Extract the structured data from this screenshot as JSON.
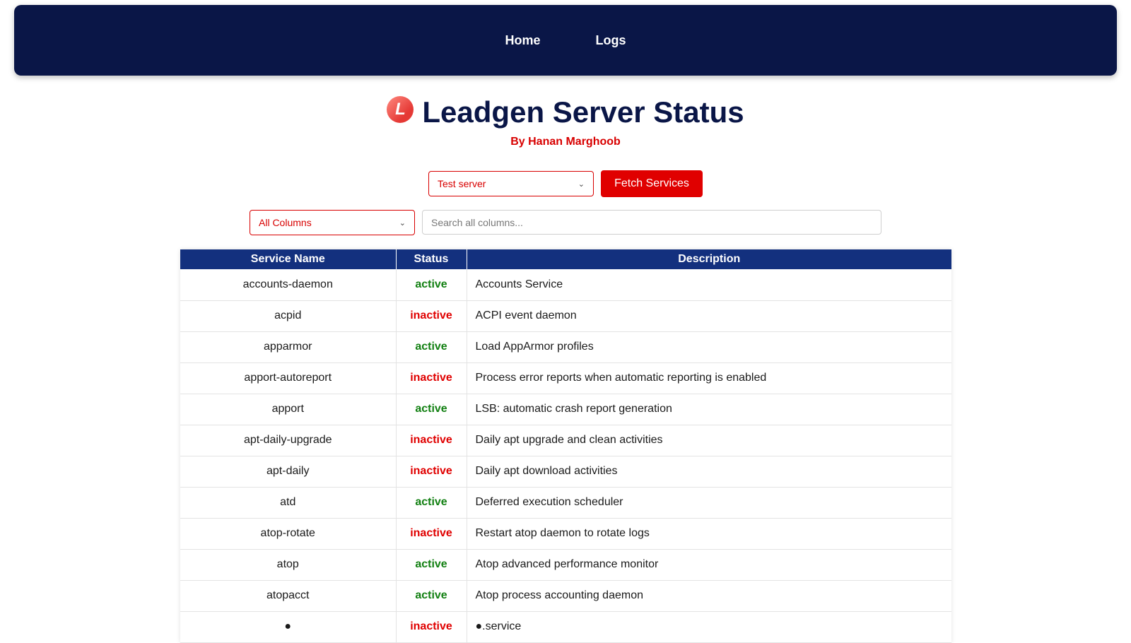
{
  "nav": {
    "home": "Home",
    "logs": "Logs"
  },
  "header": {
    "logo_letter": "L",
    "title": "Leadgen Server Status",
    "byline": "By Hanan Marghoob"
  },
  "controls": {
    "server_select_value": "Test server",
    "fetch_button": "Fetch Services",
    "column_select_value": "All Columns",
    "search_placeholder": "Search all columns..."
  },
  "colors": {
    "navbar": "#0a1647",
    "table_header": "#13307e",
    "accent_red": "#e00000",
    "active_green": "#128012"
  },
  "table": {
    "columns": [
      "Service Name",
      "Status",
      "Description"
    ],
    "rows": [
      {
        "name": "accounts-daemon",
        "status": "active",
        "description": "Accounts Service"
      },
      {
        "name": "acpid",
        "status": "inactive",
        "description": "ACPI event daemon"
      },
      {
        "name": "apparmor",
        "status": "active",
        "description": "Load AppArmor profiles"
      },
      {
        "name": "apport-autoreport",
        "status": "inactive",
        "description": "Process error reports when automatic reporting is enabled"
      },
      {
        "name": "apport",
        "status": "active",
        "description": "LSB: automatic crash report generation"
      },
      {
        "name": "apt-daily-upgrade",
        "status": "inactive",
        "description": "Daily apt upgrade and clean activities"
      },
      {
        "name": "apt-daily",
        "status": "inactive",
        "description": "Daily apt download activities"
      },
      {
        "name": "atd",
        "status": "active",
        "description": "Deferred execution scheduler"
      },
      {
        "name": "atop-rotate",
        "status": "inactive",
        "description": "Restart atop daemon to rotate logs"
      },
      {
        "name": "atop",
        "status": "active",
        "description": "Atop advanced performance monitor"
      },
      {
        "name": "atopacct",
        "status": "active",
        "description": "Atop process accounting daemon"
      },
      {
        "name": "●",
        "status": "inactive",
        "description": "●.service"
      }
    ]
  }
}
